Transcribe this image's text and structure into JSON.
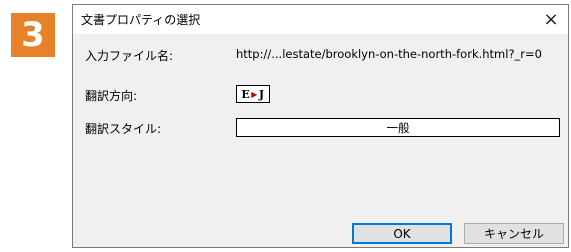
{
  "step": {
    "number": "3",
    "color": "#e8822a"
  },
  "dialog": {
    "title": "文書プロパティの選択",
    "close_label": "×",
    "fields": {
      "input_file_label": "入力ファイル名:",
      "input_file_value": "http://...lestate/brooklyn-on-the-north-fork.html?_r=0",
      "direction_label": "翻訳方向:",
      "direction_from": "E",
      "direction_arrow": "▶",
      "direction_to": "J",
      "style_label": "翻訳スタイル:",
      "style_value": "一般"
    },
    "buttons": {
      "ok": "OK",
      "cancel": "キャンセル"
    },
    "accent_color": "#0078d7"
  }
}
